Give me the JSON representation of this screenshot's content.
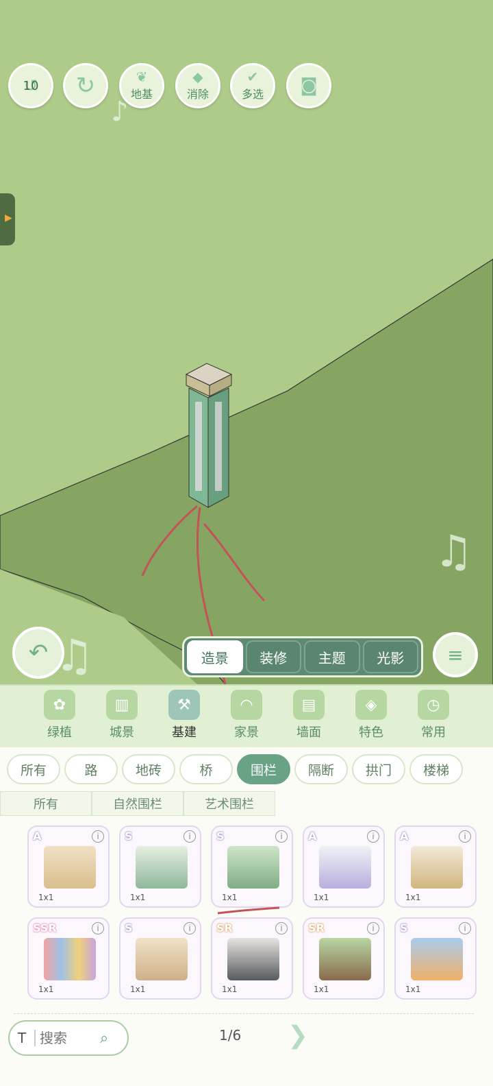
{
  "toolbar": {
    "undo_count": "10",
    "foundation": "地基",
    "erase": "消除",
    "multi_select": "多选"
  },
  "modes": [
    "造景",
    "装修",
    "主题",
    "光影"
  ],
  "categories": [
    "绿植",
    "城景",
    "基建",
    "家景",
    "墙面",
    "特色",
    "常用"
  ],
  "subcategories": [
    "所有",
    "路",
    "地砖",
    "桥",
    "围栏",
    "隔断",
    "拱门",
    "楼梯"
  ],
  "fence_types": [
    "所有",
    "自然围栏",
    "艺术围栏"
  ],
  "items": [
    {
      "rarity": "A",
      "size": "1x1"
    },
    {
      "rarity": "S",
      "size": "1x1"
    },
    {
      "rarity": "S",
      "size": "1x1"
    },
    {
      "rarity": "A",
      "size": "1x1"
    },
    {
      "rarity": "A",
      "size": "1x1"
    },
    {
      "rarity": "SSR",
      "size": "1x1"
    },
    {
      "rarity": "S",
      "size": "1x1"
    },
    {
      "rarity": "SR",
      "size": "1x1"
    },
    {
      "rarity": "SR",
      "size": "1x1"
    },
    {
      "rarity": "S",
      "size": "1x1"
    }
  ],
  "search": {
    "font_button": "T",
    "placeholder": "搜索"
  },
  "pager": "1/6",
  "icons": {
    "undo": "undo-icon",
    "redo": "redo-icon",
    "foundation": "leaf-icon",
    "erase": "eraser-icon",
    "multi": "check-icon",
    "camera": "camera-icon",
    "back": "back-arrow-icon",
    "menu": "menu-icon",
    "search": "search-icon",
    "next": "next-arrow-icon"
  },
  "colors": {
    "grass": "#aecb8a",
    "grass_dark": "#86a563",
    "accent": "#6aa286"
  }
}
